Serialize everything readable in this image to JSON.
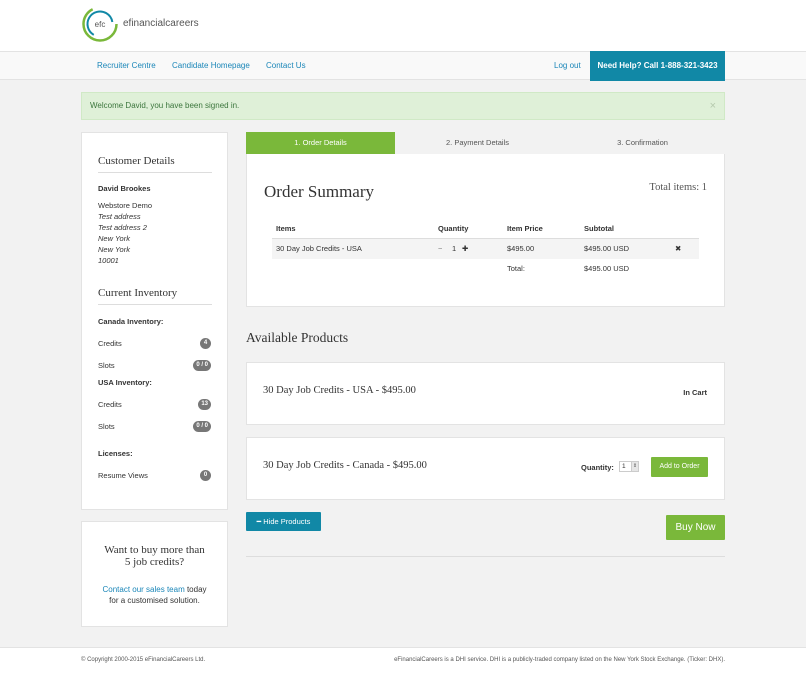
{
  "brand": {
    "logo_letters": "efc",
    "logo_text": "efinancialcareers",
    "colors": {
      "green": "#7ab83a",
      "teal": "#1188a6",
      "link": "#1a86b8"
    }
  },
  "nav": {
    "items": [
      "Recruiter Centre",
      "Candidate Homepage",
      "Contact Us"
    ],
    "logout": "Log out",
    "help": "Need Help? Call 1-888-321-3423"
  },
  "alert": {
    "text": "Welcome David, you have been signed in.",
    "close": "×"
  },
  "sidebar": {
    "customer_title": "Customer Details",
    "name": "David Brookes",
    "address": [
      "Webstore Demo",
      "Test address",
      "Test address 2",
      "New York",
      "New York",
      "10001"
    ],
    "inventory_title": "Current Inventory",
    "canada_label": "Canada Inventory:",
    "canada_credits_label": "Credits",
    "canada_credits": "4",
    "canada_slots_label": "Slots",
    "canada_slots": "0 / 0",
    "usa_label": "USA Inventory:",
    "usa_credits_label": "Credits",
    "usa_credits": "13",
    "usa_slots_label": "Slots",
    "usa_slots": "0 / 0",
    "licenses_label": "Licenses:",
    "resume_label": "Resume Views",
    "resume_views": "0"
  },
  "promo": {
    "title_1": "Want to buy more than",
    "title_2": "5 job credits?",
    "link": "Contact our sales team",
    "text_1": " today",
    "text_2": "for a customised solution."
  },
  "steps": [
    "1. Order Details",
    "2. Payment Details",
    "3. Confirmation"
  ],
  "summary": {
    "title": "Order Summary",
    "total_items": "Total items: 1",
    "headers": {
      "items": "Items",
      "quantity": "Quantity",
      "price": "Item Price",
      "subtotal": "Subtotal"
    },
    "row": {
      "item": "30 Day Job Credits - USA",
      "minus": "−",
      "qty": "1",
      "plus": "✚",
      "price": "$495.00",
      "subtotal": "$495.00 USD",
      "remove": "✖"
    },
    "total_label": "Total:",
    "total_value": "$495.00 USD"
  },
  "available": {
    "title": "Available Products",
    "products": [
      {
        "name": "30 Day Job Credits - USA - $495.00",
        "status": "In Cart"
      },
      {
        "name": "30 Day Job Credits - Canada - $495.00",
        "qty_label": "Quantity:",
        "qty": "1",
        "add_label": "Add to Order"
      }
    ],
    "hide_label": "Hide Products",
    "buy_label": "Buy Now"
  },
  "footer": {
    "copyright": "© Copyright 2000-2015 eFinancialCareers Ltd.",
    "right": "eFinancialCareers is a DHI service. DHI is a publicly-traded company listed on the New York Stock Exchange. (Ticker: DHX)."
  }
}
